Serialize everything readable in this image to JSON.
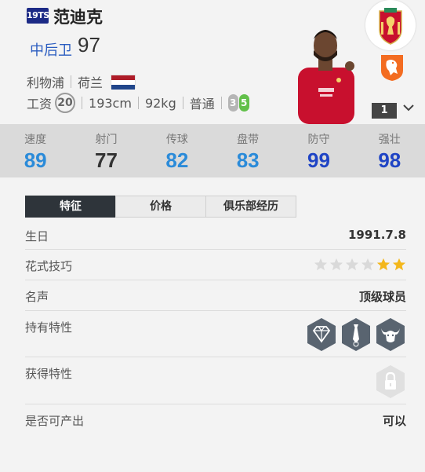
{
  "player": {
    "season": "19TS",
    "name": "范迪克",
    "position": "中后卫",
    "ovr": "97",
    "club": "利物浦",
    "nation": "荷兰",
    "salary_label": "工资",
    "salary": "20",
    "height": "193cm",
    "weight": "92kg",
    "body_type": "普通",
    "weak_foot": "3",
    "strong_foot": "5",
    "level": "1"
  },
  "colors": {
    "nl_red": "#ae1c28",
    "nl_blue": "#21468b",
    "stat_blue": "#2b8bd9",
    "stat_darkblue": "#1f44c5",
    "stat_dark": "#333333",
    "star_gold": "#f3b71b",
    "star_gray": "#d9d9d9"
  },
  "stats": [
    {
      "label": "速度",
      "value": "89",
      "color": "#2b8bd9"
    },
    {
      "label": "射门",
      "value": "77",
      "color": "#333333"
    },
    {
      "label": "传球",
      "value": "82",
      "color": "#2b8bd9"
    },
    {
      "label": "盘带",
      "value": "83",
      "color": "#2b8bd9"
    },
    {
      "label": "防守",
      "value": "99",
      "color": "#1f44c5"
    },
    {
      "label": "强壮",
      "value": "98",
      "color": "#1f44c5"
    }
  ],
  "tabs": [
    "特征",
    "价格",
    "俱乐部经历"
  ],
  "attributes": {
    "birthday_label": "生日",
    "birthday": "1991.7.8",
    "skill_label": "花式技巧",
    "skill_stars": 2,
    "skill_stars_max": 6,
    "reputation_label": "名声",
    "reputation": "顶级球员",
    "traits_label": "持有特性",
    "traits_icons": [
      "diamond-trait-icon",
      "tie-trait-icon",
      "bull-trait-icon"
    ],
    "acquired_label": "获得特性",
    "acquired_icon": "lock-icon",
    "producible_label": "是否可产出",
    "producible": "可以"
  }
}
